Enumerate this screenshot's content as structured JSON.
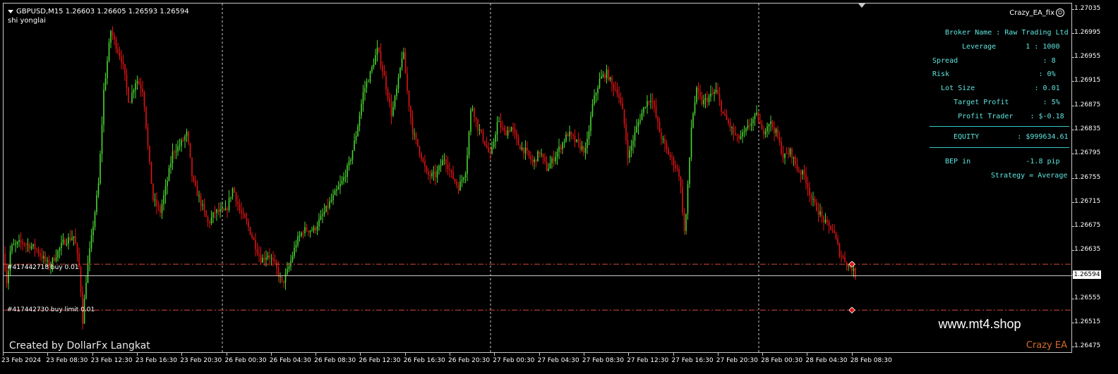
{
  "header": {
    "symbol_timeframe": "GBPUSD,M15",
    "ohlc": "1.26603 1.26605 1.26593 1.26594",
    "subtitle": "shi yonglai",
    "ea_name": "Crazy_EA_fix"
  },
  "panel": {
    "broker": "Broker Name : Raw Trading Ltd",
    "leverage": "Leverage       1 : 1000",
    "spread": "Spread                    : 8",
    "risk": "Risk                     : 0%",
    "lot_size": "  Lot Size              : 0.01",
    "target_profit": "     Target Profit        : 5%",
    "profit_trader": "      Profit Trader    : $-0.18",
    "equity": "EQUITY         : $999634.61",
    "bep": "BEP in             -1.8 pip",
    "strategy": "Strategy = Average"
  },
  "orders": [
    {
      "label": "#417442718 buy 0.01",
      "price": 1.26613
    },
    {
      "label": "#417442730 buy limit 0.01",
      "price": 1.26537
    }
  ],
  "current_price": "1.26594",
  "price_labels": [
    "1.27035",
    "1.26995",
    "1.26955",
    "1.26915",
    "1.26875",
    "1.26835",
    "1.26795",
    "1.26755",
    "1.26715",
    "1.26675",
    "1.26635",
    "1.26595",
    "1.26555",
    "1.26515",
    "1.26475"
  ],
  "time_labels": [
    "23 Feb 2024",
    "23 Feb 08:30",
    "23 Feb 12:30",
    "23 Feb 16:30",
    "23 Feb 20:30",
    "26 Feb 00:30",
    "26 Feb 04:30",
    "26 Feb 08:30",
    "26 Feb 12:30",
    "26 Feb 16:30",
    "26 Feb 20:30",
    "27 Feb 00:30",
    "27 Feb 04:30",
    "27 Feb 08:30",
    "27 Feb 12:30",
    "27 Feb 16:30",
    "27 Feb 20:30",
    "28 Feb 00:30",
    "28 Feb 04:30",
    "28 Feb 08:30"
  ],
  "watermark": "www.mt4.shop",
  "credit": "Created by DollarFx Langkat",
  "brand": "Crazy EA",
  "colors": {
    "bull": "#4bd832",
    "bear": "#e01414",
    "order_line": "#d24b3c",
    "panel_text": "#5ee6e0",
    "separator": "#ffffff"
  },
  "chart_data": {
    "type": "candlestick",
    "symbol": "GBPUSD",
    "timeframe": "M15",
    "ylim": [
      1.26465,
      1.27045
    ],
    "price_path": [
      [
        0,
        1.2663
      ],
      [
        5,
        1.2658
      ],
      [
        10,
        1.2664
      ],
      [
        25,
        1.2665
      ],
      [
        45,
        1.2664
      ],
      [
        65,
        1.2661
      ],
      [
        85,
        1.2665
      ],
      [
        100,
        1.2666
      ],
      [
        108,
        1.266
      ],
      [
        112,
        1.2652
      ],
      [
        118,
        1.266
      ],
      [
        125,
        1.2666
      ],
      [
        135,
        1.2675
      ],
      [
        142,
        1.269
      ],
      [
        152,
        1.27
      ],
      [
        158,
        1.2698
      ],
      [
        168,
        1.2695
      ],
      [
        178,
        1.2688
      ],
      [
        188,
        1.2692
      ],
      [
        198,
        1.269
      ],
      [
        205,
        1.268
      ],
      [
        212,
        1.2672
      ],
      [
        222,
        1.267
      ],
      [
        230,
        1.2674
      ],
      [
        240,
        1.268
      ],
      [
        250,
        1.2681
      ],
      [
        260,
        1.2683
      ],
      [
        268,
        1.2675
      ],
      [
        278,
        1.2672
      ],
      [
        290,
        1.2668
      ],
      [
        300,
        1.267
      ],
      [
        315,
        1.267
      ],
      [
        325,
        1.2674
      ],
      [
        335,
        1.267
      ],
      [
        345,
        1.2668
      ],
      [
        355,
        1.2665
      ],
      [
        365,
        1.2662
      ],
      [
        375,
        1.2663
      ],
      [
        385,
        1.2661
      ],
      [
        395,
        1.2658
      ],
      [
        405,
        1.2661
      ],
      [
        415,
        1.2665
      ],
      [
        425,
        1.2667
      ],
      [
        440,
        1.2667
      ],
      [
        455,
        1.267
      ],
      [
        470,
        1.2673
      ],
      [
        480,
        1.2675
      ],
      [
        490,
        1.2678
      ],
      [
        500,
        1.2683
      ],
      [
        510,
        1.269
      ],
      [
        520,
        1.2693
      ],
      [
        530,
        1.2697
      ],
      [
        540,
        1.2692
      ],
      [
        550,
        1.2686
      ],
      [
        560,
        1.2692
      ],
      [
        566,
        1.2697
      ],
      [
        572,
        1.269
      ],
      [
        580,
        1.2683
      ],
      [
        590,
        1.268
      ],
      [
        600,
        1.2676
      ],
      [
        612,
        1.2676
      ],
      [
        625,
        1.2679
      ],
      [
        635,
        1.2676
      ],
      [
        645,
        1.2674
      ],
      [
        655,
        1.2677
      ],
      [
        663,
        1.2688
      ],
      [
        672,
        1.2684
      ],
      [
        680,
        1.2682
      ],
      [
        690,
        1.2679
      ],
      [
        700,
        1.2685
      ],
      [
        710,
        1.2683
      ],
      [
        720,
        1.2684
      ],
      [
        730,
        1.2681
      ],
      [
        740,
        1.268
      ],
      [
        750,
        1.2678
      ],
      [
        760,
        1.268
      ],
      [
        770,
        1.2677
      ],
      [
        780,
        1.2679
      ],
      [
        790,
        1.2681
      ],
      [
        800,
        1.2683
      ],
      [
        808,
        1.2682
      ],
      [
        815,
        1.2681
      ],
      [
        825,
        1.268
      ],
      [
        835,
        1.2688
      ],
      [
        845,
        1.2692
      ],
      [
        855,
        1.2693
      ],
      [
        862,
        1.2691
      ],
      [
        870,
        1.269
      ],
      [
        878,
        1.2686
      ],
      [
        885,
        1.2679
      ],
      [
        892,
        1.2682
      ],
      [
        900,
        1.2685
      ],
      [
        910,
        1.2688
      ],
      [
        918,
        1.2689
      ],
      [
        930,
        1.2683
      ],
      [
        940,
        1.268
      ],
      [
        950,
        1.2678
      ],
      [
        958,
        1.2676
      ],
      [
        965,
        1.2666
      ],
      [
        970,
        1.2675
      ],
      [
        975,
        1.2685
      ],
      [
        982,
        1.269
      ],
      [
        990,
        1.2688
      ],
      [
        1000,
        1.2689
      ],
      [
        1010,
        1.269
      ],
      [
        1020,
        1.2686
      ],
      [
        1030,
        1.2684
      ],
      [
        1040,
        1.2682
      ],
      [
        1050,
        1.2683
      ],
      [
        1060,
        1.2685
      ],
      [
        1068,
        1.2686
      ],
      [
        1075,
        1.2683
      ],
      [
        1085,
        1.2685
      ],
      [
        1095,
        1.2683
      ],
      [
        1105,
        1.2679
      ],
      [
        1115,
        1.268
      ],
      [
        1125,
        1.2677
      ],
      [
        1135,
        1.2676
      ],
      [
        1145,
        1.2672
      ],
      [
        1155,
        1.267
      ],
      [
        1165,
        1.2668
      ],
      [
        1175,
        1.2667
      ],
      [
        1185,
        1.2663
      ],
      [
        1192,
        1.2662
      ],
      [
        1197,
        1.2661
      ],
      [
        1203,
        1.26605
      ],
      [
        1207,
        1.26594
      ]
    ]
  }
}
